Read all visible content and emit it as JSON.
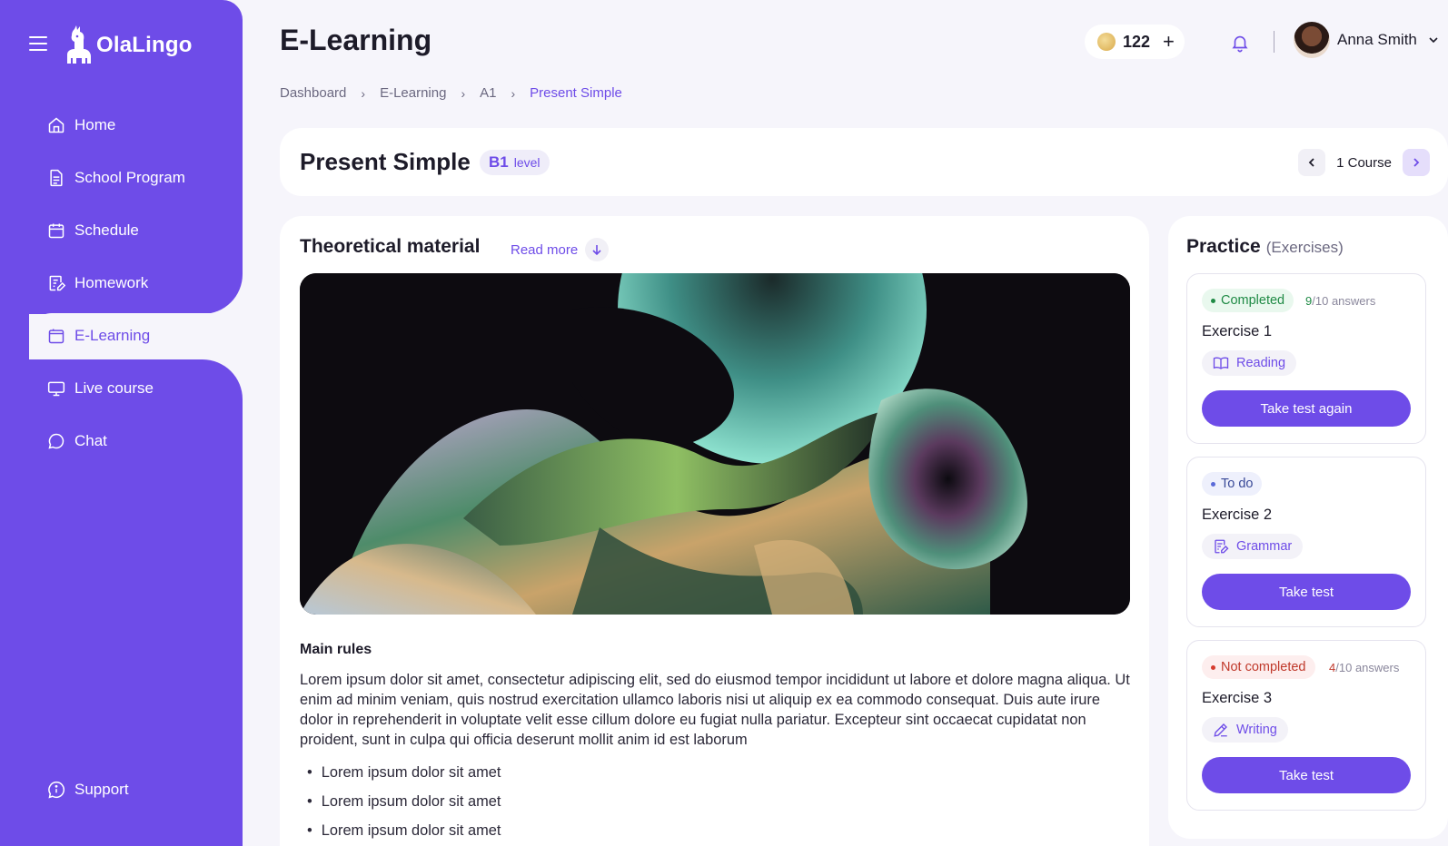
{
  "app": {
    "logo_text": "OlaLingo",
    "page_title": "E-Learning"
  },
  "sidebar": {
    "items": [
      {
        "label": "Home",
        "icon": "home-icon"
      },
      {
        "label": "School Program",
        "icon": "document-icon"
      },
      {
        "label": "Schedule",
        "icon": "calendar-icon"
      },
      {
        "label": "Homework",
        "icon": "homework-icon"
      },
      {
        "label": "E-Learning",
        "icon": "folder-icon",
        "active": true
      },
      {
        "label": "Live course",
        "icon": "monitor-icon"
      },
      {
        "label": "Chat",
        "icon": "chat-icon"
      }
    ],
    "support_label": "Support"
  },
  "header": {
    "coins": "122",
    "coin_plus": "+",
    "user_name": "Anna Smith"
  },
  "breadcrumb": {
    "items": [
      "Dashboard",
      "E-Learning",
      "A1"
    ],
    "current": "Present Simple"
  },
  "lesson": {
    "title": "Present Simple",
    "level_code": "B1",
    "level_word": "level",
    "course_label": "1 Course"
  },
  "theory": {
    "title": "Theoretical material",
    "read_more": "Read more",
    "section_heading": "Main rules",
    "paragraph": "Lorem ipsum dolor sit amet, consectetur adipiscing elit, sed do eiusmod tempor incididunt ut labore et dolore magna aliqua. Ut enim ad minim veniam, quis nostrud exercitation ullamco laboris nisi ut aliquip ex ea commodo consequat. Duis aute irure dolor in reprehenderit in voluptate velit esse cillum dolore eu fugiat nulla pariatur. Excepteur sint occaecat cupidatat non proident, sunt in culpa qui officia deserunt mollit anim id est laborum",
    "bullets": [
      "Lorem ipsum dolor sit amet",
      "Lorem ipsum dolor sit amet",
      "Lorem ipsum dolor sit amet"
    ]
  },
  "practice": {
    "title": "Practice",
    "subtitle": "(Exercises)",
    "exercises": [
      {
        "status": "Completed",
        "answered": "9",
        "total": "/10",
        "answers_word": "answers",
        "name": "Exercise 1",
        "skill": "Reading",
        "button": "Take test again"
      },
      {
        "status": "To do",
        "name": "Exercise 2",
        "skill": "Grammar",
        "button": "Take test"
      },
      {
        "status": "Not completed",
        "answered": "4",
        "total": "/10",
        "answers_word": "answers",
        "name": "Exercise 3",
        "skill": "Writing",
        "button": "Take test"
      }
    ]
  },
  "colors": {
    "brand": "#6e4ce8",
    "background": "#f6f5fb",
    "completed": "#1f8a45",
    "todo": "#3a4a98",
    "not_completed": "#c0392b"
  }
}
